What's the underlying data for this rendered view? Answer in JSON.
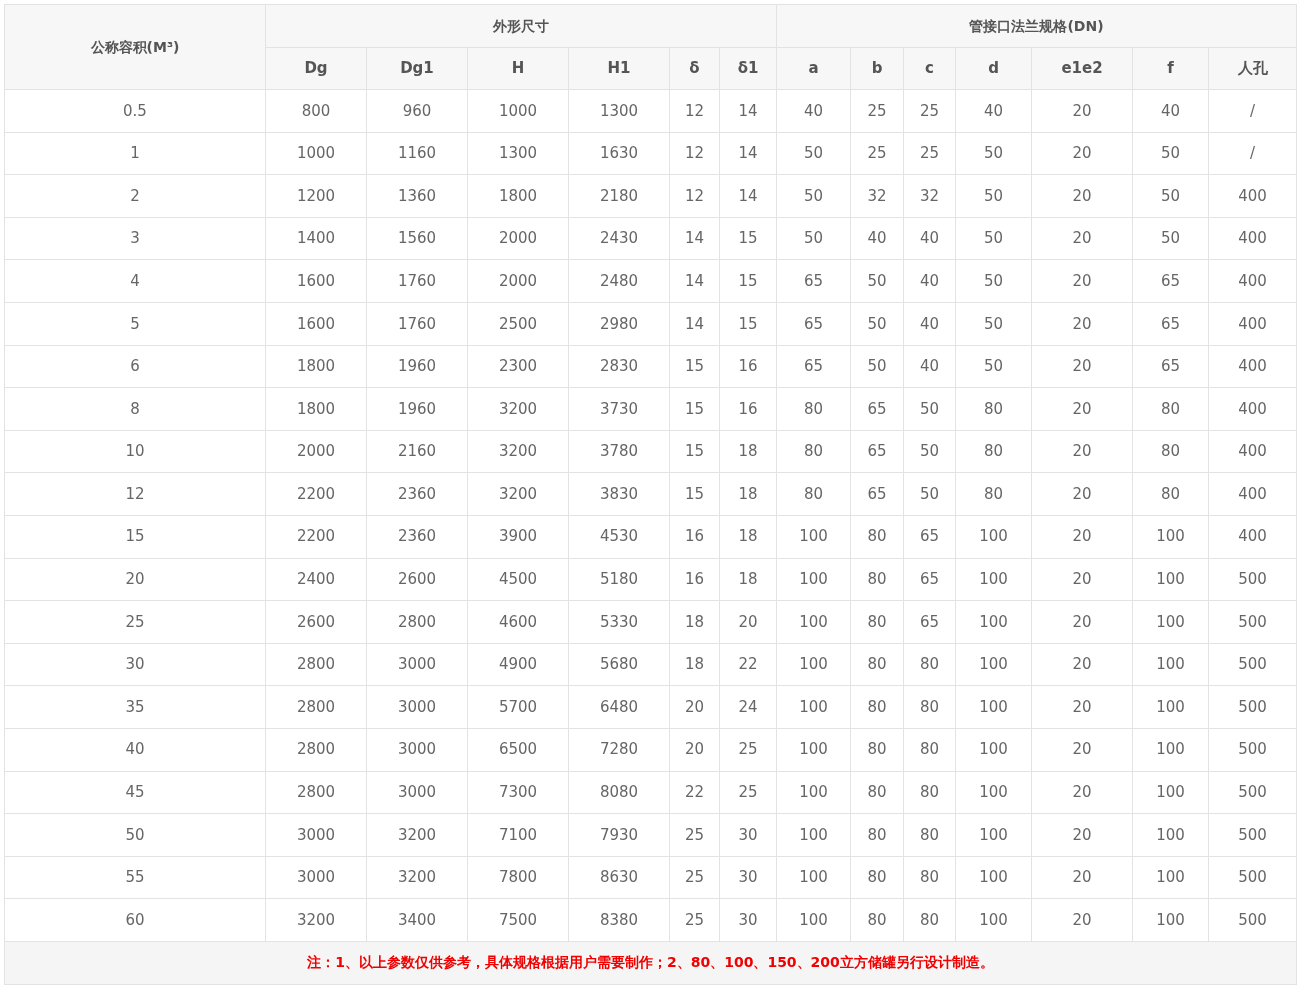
{
  "table": {
    "corner_header": "公称容积(M³)",
    "groups": [
      {
        "label": "外形尺寸",
        "columns": [
          "Dg",
          "Dg1",
          "H",
          "H1",
          "δ",
          "δ1"
        ]
      },
      {
        "label": "管接口法兰规格(DN)",
        "columns": [
          "a",
          "b",
          "c",
          "d",
          "e1e2",
          "f",
          "人孔"
        ]
      }
    ],
    "rows": [
      [
        "0.5",
        "800",
        "960",
        "1000",
        "1300",
        "12",
        "14",
        "40",
        "25",
        "25",
        "40",
        "20",
        "40",
        "/"
      ],
      [
        "1",
        "1000",
        "1160",
        "1300",
        "1630",
        "12",
        "14",
        "50",
        "25",
        "25",
        "50",
        "20",
        "50",
        "/"
      ],
      [
        "2",
        "1200",
        "1360",
        "1800",
        "2180",
        "12",
        "14",
        "50",
        "32",
        "32",
        "50",
        "20",
        "50",
        "400"
      ],
      [
        "3",
        "1400",
        "1560",
        "2000",
        "2430",
        "14",
        "15",
        "50",
        "40",
        "40",
        "50",
        "20",
        "50",
        "400"
      ],
      [
        "4",
        "1600",
        "1760",
        "2000",
        "2480",
        "14",
        "15",
        "65",
        "50",
        "40",
        "50",
        "20",
        "65",
        "400"
      ],
      [
        "5",
        "1600",
        "1760",
        "2500",
        "2980",
        "14",
        "15",
        "65",
        "50",
        "40",
        "50",
        "20",
        "65",
        "400"
      ],
      [
        "6",
        "1800",
        "1960",
        "2300",
        "2830",
        "15",
        "16",
        "65",
        "50",
        "40",
        "50",
        "20",
        "65",
        "400"
      ],
      [
        "8",
        "1800",
        "1960",
        "3200",
        "3730",
        "15",
        "16",
        "80",
        "65",
        "50",
        "80",
        "20",
        "80",
        "400"
      ],
      [
        "10",
        "2000",
        "2160",
        "3200",
        "3780",
        "15",
        "18",
        "80",
        "65",
        "50",
        "80",
        "20",
        "80",
        "400"
      ],
      [
        "12",
        "2200",
        "2360",
        "3200",
        "3830",
        "15",
        "18",
        "80",
        "65",
        "50",
        "80",
        "20",
        "80",
        "400"
      ],
      [
        "15",
        "2200",
        "2360",
        "3900",
        "4530",
        "16",
        "18",
        "100",
        "80",
        "65",
        "100",
        "20",
        "100",
        "400"
      ],
      [
        "20",
        "2400",
        "2600",
        "4500",
        "5180",
        "16",
        "18",
        "100",
        "80",
        "65",
        "100",
        "20",
        "100",
        "500"
      ],
      [
        "25",
        "2600",
        "2800",
        "4600",
        "5330",
        "18",
        "20",
        "100",
        "80",
        "65",
        "100",
        "20",
        "100",
        "500"
      ],
      [
        "30",
        "2800",
        "3000",
        "4900",
        "5680",
        "18",
        "22",
        "100",
        "80",
        "80",
        "100",
        "20",
        "100",
        "500"
      ],
      [
        "35",
        "2800",
        "3000",
        "5700",
        "6480",
        "20",
        "24",
        "100",
        "80",
        "80",
        "100",
        "20",
        "100",
        "500"
      ],
      [
        "40",
        "2800",
        "3000",
        "6500",
        "7280",
        "20",
        "25",
        "100",
        "80",
        "80",
        "100",
        "20",
        "100",
        "500"
      ],
      [
        "45",
        "2800",
        "3000",
        "7300",
        "8080",
        "22",
        "25",
        "100",
        "80",
        "80",
        "100",
        "20",
        "100",
        "500"
      ],
      [
        "50",
        "3000",
        "3200",
        "7100",
        "7930",
        "25",
        "30",
        "100",
        "80",
        "80",
        "100",
        "20",
        "100",
        "500"
      ],
      [
        "55",
        "3000",
        "3200",
        "7800",
        "8630",
        "25",
        "30",
        "100",
        "80",
        "80",
        "100",
        "20",
        "100",
        "500"
      ],
      [
        "60",
        "3200",
        "3400",
        "7500",
        "8380",
        "25",
        "30",
        "100",
        "80",
        "80",
        "100",
        "20",
        "100",
        "500"
      ]
    ],
    "note": "注：1、以上参数仅供参考，具体规格根据用户需要制作；2、80、100、150、200立方储罐另行设计制造。"
  }
}
